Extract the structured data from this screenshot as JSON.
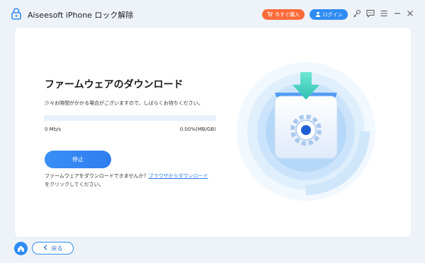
{
  "app": {
    "title": "Aiseesoft iPhone ロック解除"
  },
  "toolbar": {
    "buy_label": "今すぐ購入",
    "login_label": "ログイン",
    "icons": [
      "key-icon",
      "chat-icon",
      "menu-icon",
      "minimize-icon",
      "close-icon"
    ]
  },
  "download": {
    "heading": "ファームウェアのダウンロード",
    "wait_message": "少々お時間がかかる場合がございますので、しばらくお待ちください。",
    "speed": "0 Mb/s",
    "progress_text": "0.00%(MB/GB)",
    "progress_fraction": 0,
    "stop_label": "停止",
    "help_prefix": "ファームウェアをダウンロードできませんか？",
    "help_link": "ブラウザからダウンロード",
    "help_suffix": "をクリックしてください。"
  },
  "footer": {
    "back_label": "戻る"
  },
  "colors": {
    "accent": "#2f8cf3",
    "buy": "#ff6a3a",
    "background": "#eef3f9"
  }
}
